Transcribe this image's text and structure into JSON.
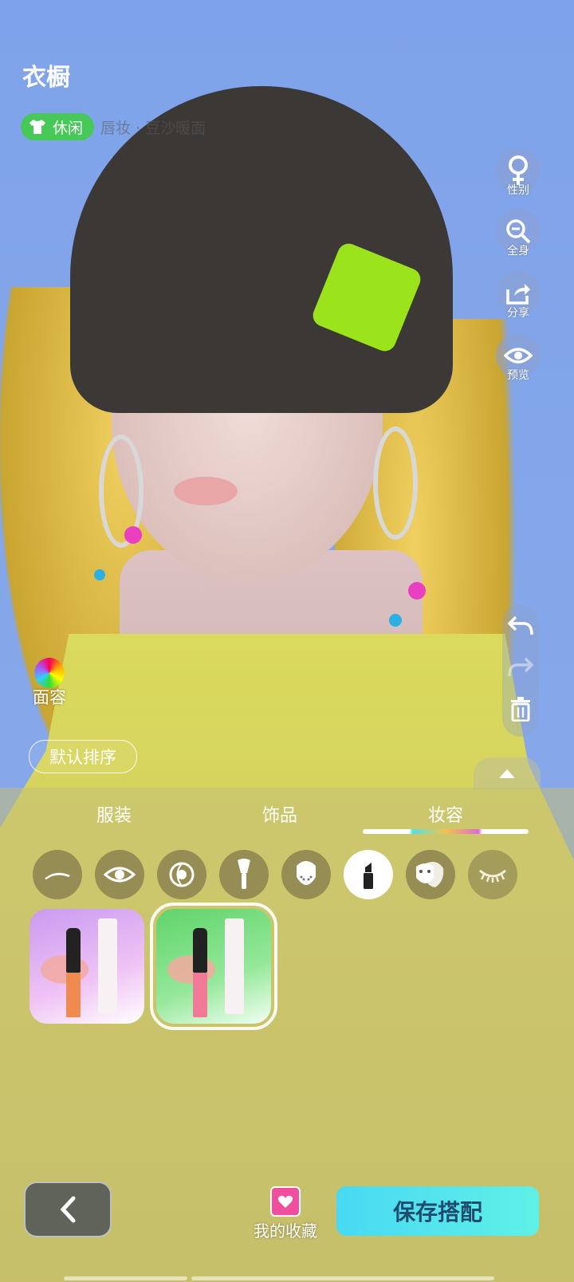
{
  "header": {
    "title": "衣橱",
    "style_tag": "休闲",
    "current_item": "唇妆 · 豆沙暖面"
  },
  "right_tools": [
    {
      "name": "性别",
      "icon": "female-icon"
    },
    {
      "name": "全身",
      "icon": "zoom-out-icon"
    },
    {
      "name": "分享",
      "icon": "share-icon"
    },
    {
      "name": "预览",
      "icon": "eye-icon"
    }
  ],
  "face_button": {
    "label": "面容",
    "icon": "palette-icon"
  },
  "sort_button": {
    "label": "默认排序"
  },
  "tabs": [
    {
      "label": "服装",
      "active": false
    },
    {
      "label": "饰品",
      "active": false
    },
    {
      "label": "妆容",
      "active": true
    }
  ],
  "makeup_categories": [
    {
      "icon": "eyebrow-icon",
      "active": false
    },
    {
      "icon": "eye-icon",
      "active": false
    },
    {
      "icon": "iris-icon",
      "active": false
    },
    {
      "icon": "brush-icon",
      "active": false
    },
    {
      "icon": "face-freckles-icon",
      "active": false
    },
    {
      "icon": "lipstick-icon",
      "active": true
    },
    {
      "icon": "face-paint-icon",
      "active": false
    },
    {
      "icon": "eyelash-icon",
      "active": false
    }
  ],
  "items": [
    {
      "icon": "lipstick-orange-icon",
      "selected": false,
      "bg": "#e9b8f0",
      "color": "#f08a4e"
    },
    {
      "icon": "lipstick-pink-icon",
      "selected": true,
      "bg": "#7fe08a",
      "color": "#f07a98"
    }
  ],
  "bottom_bar": {
    "favorites_label": "我的收藏",
    "save_label": "保存搭配"
  },
  "colors": {
    "accent": "#47c95a",
    "save": "#48d9f3"
  }
}
